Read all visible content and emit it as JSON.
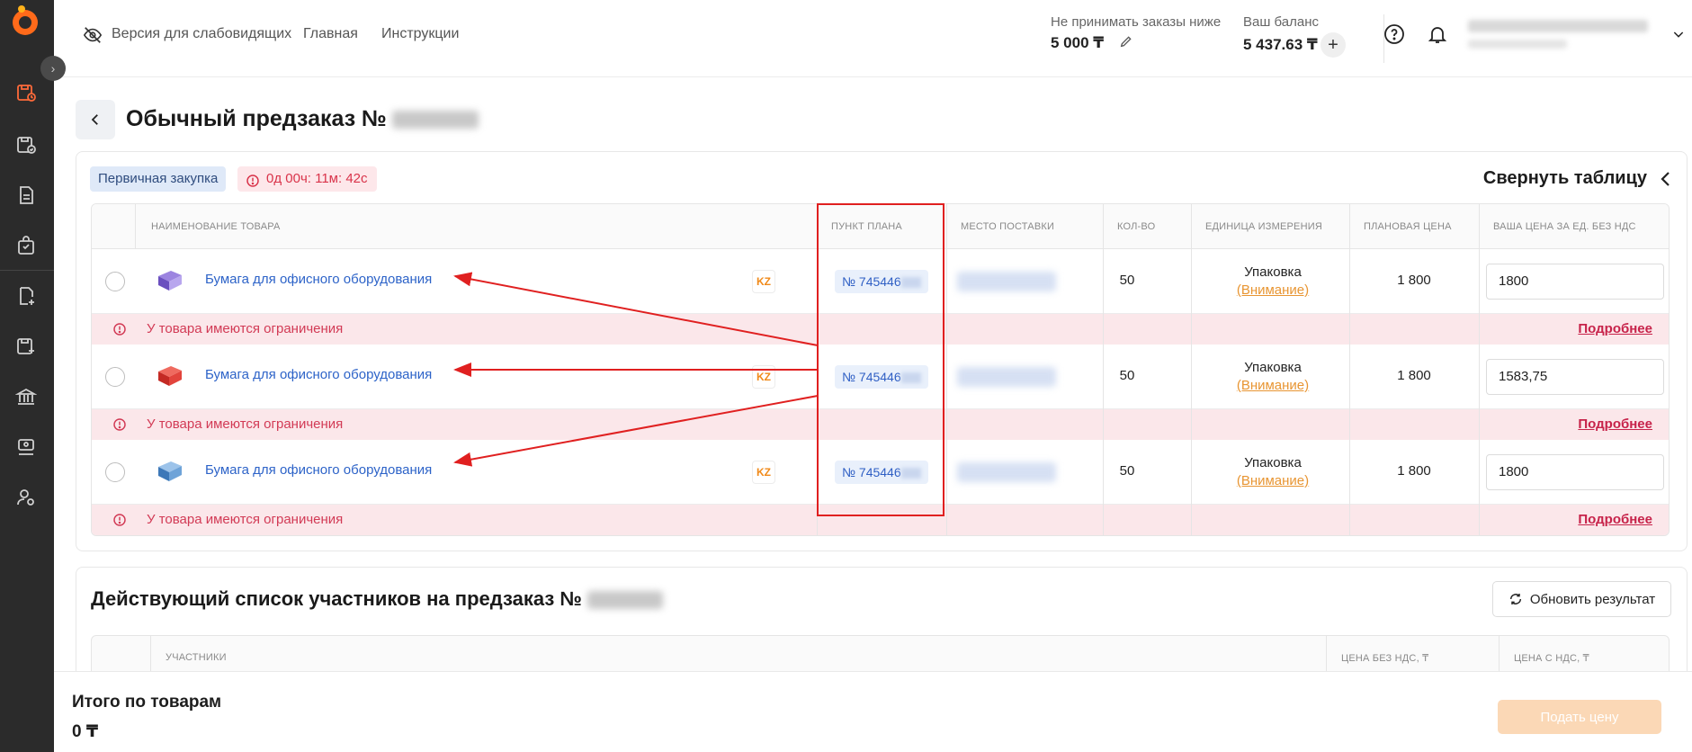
{
  "header": {
    "accessibility_label": "Версия для слабовидящих",
    "nav_home": "Главная",
    "nav_instructions": "Инструкции",
    "min_order_label": "Не принимать заказы ниже",
    "min_order_value": "5 000 ₸",
    "balance_label": "Ваш баланс",
    "balance_value": "5 437.63 ₸"
  },
  "page": {
    "title": "Обычный предзаказ №"
  },
  "badges": {
    "type": "Первичная закупка",
    "timer": "0д 00ч: 11м: 42с"
  },
  "collapse_label": "Свернуть таблицу",
  "table": {
    "columns": {
      "name": "НАИМЕНОВАНИЕ ТОВАРА",
      "plan": "ПУНКТ ПЛАНА",
      "place": "МЕСТО ПОСТАВКИ",
      "qty": "КОЛ-ВО",
      "unit": "ЕДИНИЦА ИЗМЕРЕНИЯ",
      "plan_price": "ПЛАНОВАЯ ЦЕНА",
      "your_price": "ВАША ЦЕНА ЗА ЕД. БЕЗ НДС"
    },
    "rows": [
      {
        "name": "Бумага для офисного оборудования",
        "origin": "KZ",
        "plan": "№ 745446",
        "qty": "50",
        "unit": "Упаковка",
        "unit_note": "(Внимание)",
        "plan_price": "1 800",
        "your_price": "1800",
        "thumb_color": "#7b5bc8"
      },
      {
        "name": "Бумага для офисного оборудования",
        "origin": "KZ",
        "plan": "№ 745446",
        "qty": "50",
        "unit": "Упаковка",
        "unit_note": "(Внимание)",
        "plan_price": "1 800",
        "your_price": "1583,75",
        "thumb_color": "#d8322f"
      },
      {
        "name": "Бумага для офисного оборудования",
        "origin": "KZ",
        "plan": "№ 745446",
        "qty": "50",
        "unit": "Упаковка",
        "unit_note": "(Внимание)",
        "plan_price": "1 800",
        "your_price": "1800",
        "thumb_color": "#4f89c9"
      }
    ],
    "warning_text": "У товара имеются ограничения",
    "warning_link": "Подробнее"
  },
  "participants": {
    "title": "Действующий список участников на предзаказ №",
    "refresh": "Обновить результат",
    "col_participants": "УЧАСТНИКИ",
    "col_price_no_vat": "ЦЕНА БЕЗ НДС, ₸",
    "col_price_vat": "ЦЕНА С НДС, ₸"
  },
  "footer": {
    "total_label": "Итого по товарам",
    "total_value": "0 ₸",
    "submit": "Подать цену"
  },
  "colors": {
    "accent_orange": "#f08a1a",
    "link_blue": "#2d63c8",
    "warning_bg": "#fbe7ea",
    "warning_text": "#d23a55",
    "annotation_red": "#e02020"
  }
}
